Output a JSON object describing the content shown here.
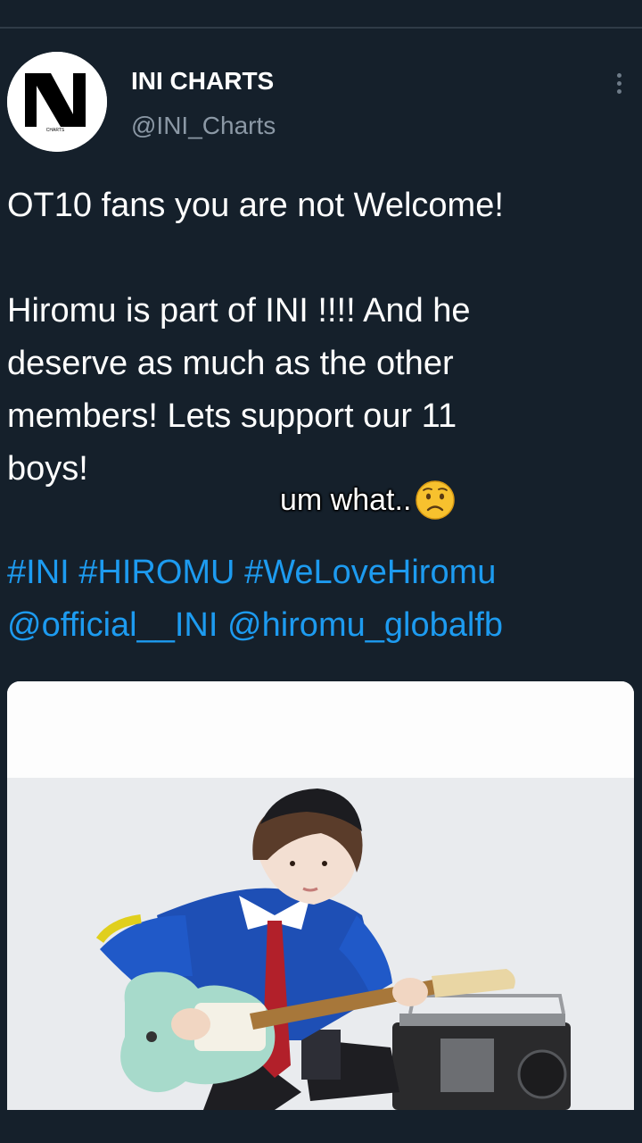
{
  "tweet": {
    "author": {
      "display_name": "INI CHARTS",
      "handle": "@INI_Charts",
      "avatar_label": "CHARTS"
    },
    "text_lines": [
      "OT10 fans you are not Welcome!",
      "Hiromu is part of INI !!!! And he",
      "deserve as much as the other",
      "members! Lets support our 11",
      "boys!"
    ],
    "hashtags": [
      "#INI",
      "#HIROMU",
      "#WeLoveHiromu"
    ],
    "mentions": [
      "@official__INI",
      "@hiromu_globalfb"
    ],
    "media": {
      "photo_icon": "photo-of-person-with-guitar"
    }
  },
  "overlay": {
    "caption": "um what..",
    "emoji": "worried-face-emoji"
  },
  "colors": {
    "background": "#15202b",
    "text": "#ffffff",
    "secondary_text": "#8b98a5",
    "link": "#1d9bf0"
  }
}
